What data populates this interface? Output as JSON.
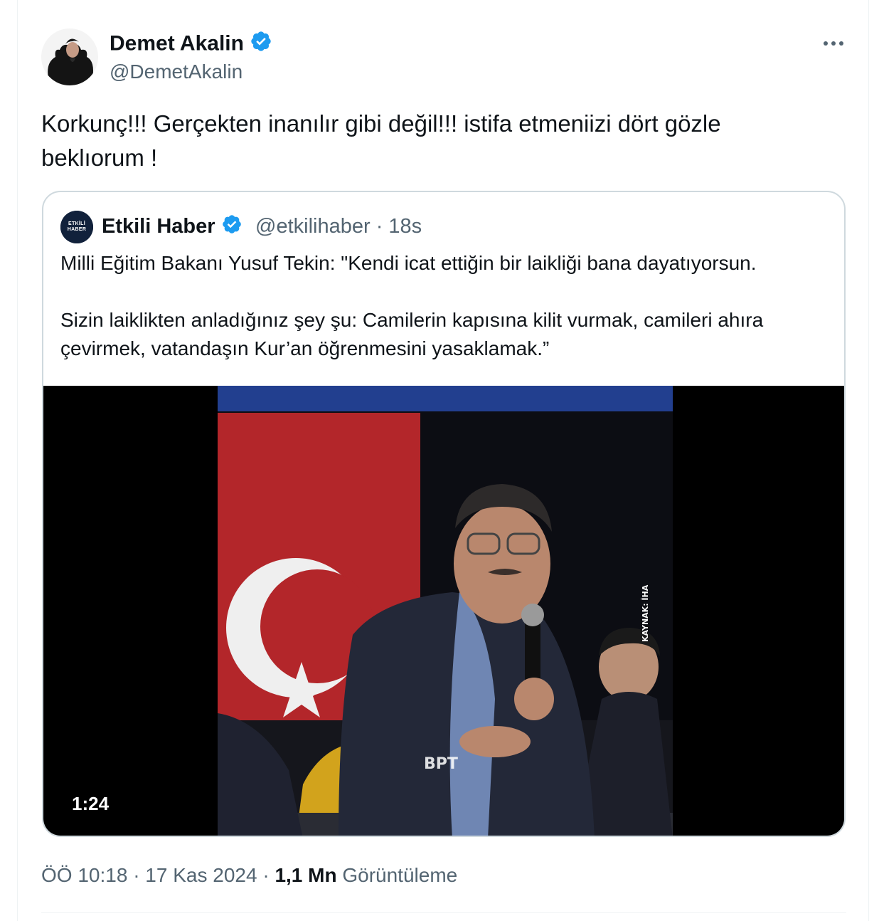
{
  "author": {
    "name": "Demet Akalin",
    "handle": "@DemetAkalin"
  },
  "tweet": {
    "text": "Korkunç!!! Gerçekten inanılır gibi değil!!! istifa etmeniizi dört gözle\nbeklıorum !"
  },
  "quote": {
    "avatar_text": "ETKİLİ HABER",
    "name": "Etkili Haber",
    "handle": "@etkilihaber",
    "separator": "·",
    "time": "18s",
    "text": "Milli Eğitim Bakanı Yusuf Tekin: \"Kendi icat ettiğin bir laikliği bana dayatıyorsun.\n\nSizin laiklikten anladığınız şey şu: Camilerin kapısına kilit vurmak, camileri ahıra\nçevirmek, vatandaşın Kur’an öğrenmesini yasaklamak.”",
    "video": {
      "duration": "1:24",
      "watermark": "KAYNAK: İHA",
      "logo": "BPT"
    }
  },
  "footer": {
    "time": "ÖÖ 10:18",
    "sep1": "·",
    "date": "17 Kas 2024",
    "sep2": "·",
    "views_count": "1,1 Mn",
    "views_label": "Görüntüleme"
  },
  "icons": [
    "verified-badge-icon",
    "more-options-icon"
  ],
  "colors": {
    "verified": "#1d9bf0",
    "secondary_text": "#536471",
    "border": "#cfd9de"
  }
}
